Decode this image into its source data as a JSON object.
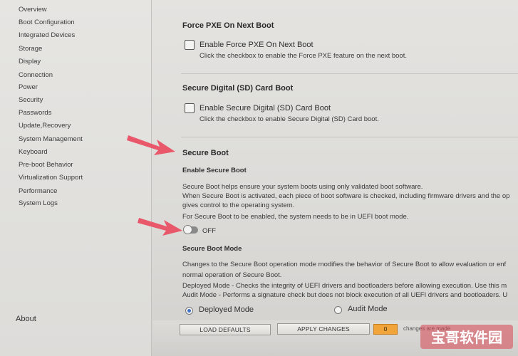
{
  "sidebar": {
    "items": [
      {
        "label": "Overview"
      },
      {
        "label": "Boot Configuration"
      },
      {
        "label": "Integrated Devices"
      },
      {
        "label": "Storage"
      },
      {
        "label": "Display"
      },
      {
        "label": "Connection"
      },
      {
        "label": "Power"
      },
      {
        "label": "Security"
      },
      {
        "label": "Passwords"
      },
      {
        "label": "Update,Recovery"
      },
      {
        "label": "System Management"
      },
      {
        "label": "Keyboard"
      },
      {
        "label": "Pre-boot Behavior"
      },
      {
        "label": "Virtualization Support"
      },
      {
        "label": "Performance"
      },
      {
        "label": "System Logs"
      }
    ],
    "about_label": "About"
  },
  "main": {
    "pxe": {
      "title": "Force PXE On Next Boot",
      "checkbox_label": "Enable Force PXE On Next Boot",
      "checked": false,
      "description": "Click the checkbox to enable the Force PXE feature on the next boot."
    },
    "sd": {
      "title": "Secure Digital (SD) Card Boot",
      "checkbox_label": "Enable Secure Digital (SD) Card Boot",
      "checked": false,
      "description": "Click the checkbox to enable Secure Digital (SD) Card boot."
    },
    "secure_boot": {
      "title": "Secure Boot",
      "enable_title": "Enable Secure Boot",
      "description_lines": [
        "Secure Boot helps ensure your system boots using only validated boot software.",
        "When Secure Boot is activated, each piece of boot software is checked, including firmware drivers and the op",
        "gives control to the operating system.",
        "For Secure Boot to be enabled, the system needs to be in UEFI boot mode."
      ],
      "toggle_state": "OFF",
      "mode_title": "Secure Boot Mode",
      "mode_description_lines": [
        "Changes to the Secure Boot operation mode modifies the behavior of Secure Boot to allow evaluation or enf",
        "normal operation of Secure Boot.",
        "Deployed Mode - Checks the integrity of UEFI drivers and bootloaders before allowing execution. Use this m",
        "Audit Mode - Performs a signature check but does not block execution of all UEFI drivers and bootloaders. U"
      ],
      "mode_options": [
        {
          "label": "Deployed Mode",
          "selected": true
        },
        {
          "label": "Audit Mode",
          "selected": false
        }
      ]
    }
  },
  "bottom_bar": {
    "load_defaults_label": "LOAD DEFAULTS",
    "apply_changes_label": "APPLY CHANGES",
    "changes_count": "0",
    "changes_text": "changes are made"
  },
  "watermark": {
    "text": "宝哥软件园"
  },
  "colors": {
    "accent_orange": "#f1a43a",
    "arrow_pink": "#e8586a",
    "radio_blue": "#3d6fc4"
  }
}
